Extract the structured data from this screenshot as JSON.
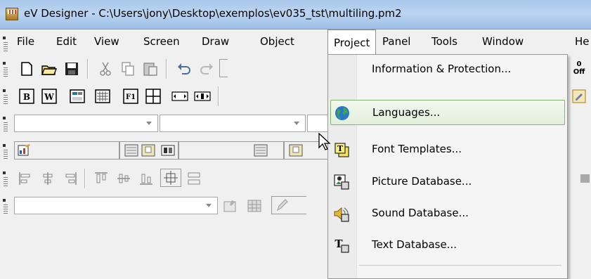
{
  "window": {
    "title": "eV Designer - C:\\Users\\jony\\Desktop\\exemplos\\ev035_tst\\multiling.pm2"
  },
  "menubar": {
    "items": [
      "File",
      "Edit",
      "View",
      "Screen",
      "Draw",
      "Object",
      "Project",
      "Panel",
      "Tools",
      "Window",
      "He"
    ],
    "open_item": "Project"
  },
  "toolbar_right": {
    "status_top": "0",
    "status_bottom": "Off"
  },
  "project_menu": {
    "items": [
      {
        "label": "Information & Protection...",
        "icon": "none",
        "highlighted": false
      },
      {
        "label": "Languages...",
        "icon": "globe-icon",
        "highlighted": true
      },
      {
        "label": "Font Templates...",
        "icon": "font-template-icon",
        "highlighted": false
      },
      {
        "label": "Picture Database...",
        "icon": "picture-database-icon",
        "highlighted": false
      },
      {
        "label": "Sound Database...",
        "icon": "sound-database-icon",
        "highlighted": false
      },
      {
        "label": "Text Database...",
        "icon": "text-database-icon",
        "highlighted": false
      }
    ]
  },
  "colors": {
    "titlebar": "#a8c7ea",
    "highlight_border": "#86b36e",
    "highlight_fill": "#e1f0da"
  }
}
